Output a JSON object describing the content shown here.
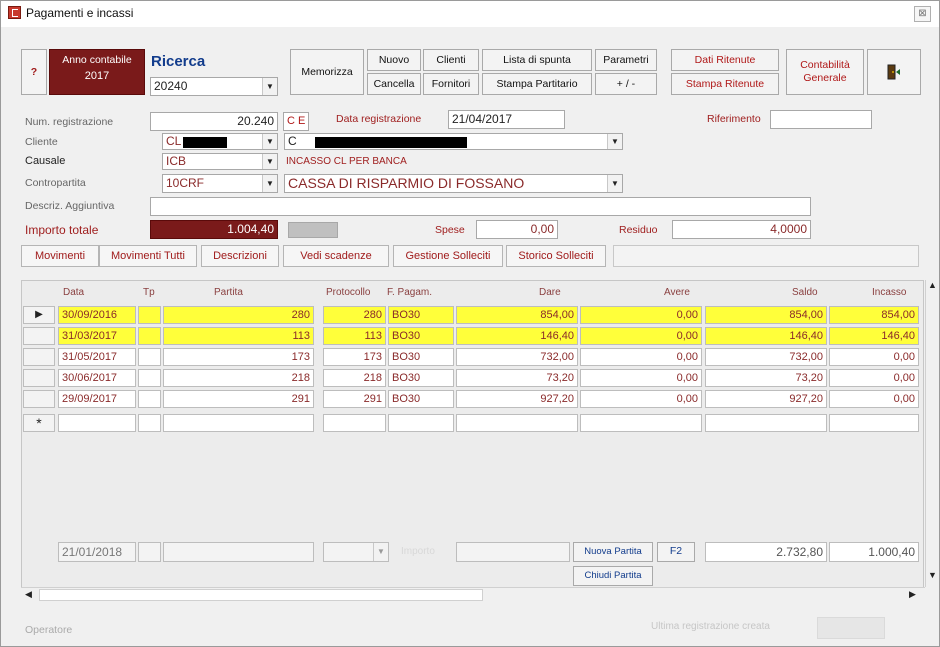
{
  "window": {
    "title": "Pagamenti e incassi",
    "close_label": "⊠"
  },
  "toolbar": {
    "help_label": "?",
    "anno_label": "Anno contabile",
    "anno_value": "2017",
    "ricerca_label": "Ricerca",
    "ricerca_value": "20240",
    "memorizza": "Memorizza",
    "nuovo": "Nuovo",
    "cancella": "Cancella",
    "clienti": "Clienti",
    "fornitori": "Fornitori",
    "lista_spunta": "Lista di spunta",
    "stampa_partitario": "Stampa Partitario",
    "parametri": "Parametri",
    "plus_minus": "+ / -",
    "dati_ritenute": "Dati Ritenute",
    "stampa_ritenute": "Stampa Ritenute",
    "contabilita_generale": "Contabilità Generale"
  },
  "form": {
    "num_reg_label": "Num. registrazione",
    "num_reg_value": "20.240",
    "ce_label": "C E",
    "data_reg_label": "Data registrazione",
    "data_reg_value": "21/04/2017",
    "riferimento_label": "Riferimento",
    "riferimento_value": "",
    "cliente_label": "Cliente",
    "cliente_code": "CL",
    "cliente_name": "C",
    "causale_label": "Causale",
    "causale_code": "ICB",
    "causale_desc": "INCASSO CL PER BANCA",
    "contropartita_label": "Contropartita",
    "contropartita_code": "10CRF",
    "contropartita_desc": "CASSA DI RISPARMIO DI FOSSANO",
    "descr_label": "Descriz. Aggiuntiva",
    "descr_value": "",
    "importo_label": "Importo totale",
    "importo_value": "1.004,40",
    "spese_label": "Spese",
    "spese_value": "0,00",
    "residuo_label": "Residuo",
    "residuo_value": "4,0000"
  },
  "tabs": [
    "Movimenti",
    "Movimenti Tutti",
    "Descrizioni",
    "Vedi scadenze",
    "Gestione Solleciti",
    "Storico Solleciti"
  ],
  "table": {
    "columns": [
      "Data",
      "Tp",
      "Partita",
      "Protocollo",
      "F. Pagam.",
      "Dare",
      "Avere",
      "Saldo",
      "Incasso"
    ],
    "rows": [
      {
        "data": "30/09/2016",
        "tp": "",
        "partita": "280",
        "protocollo": "280",
        "fpag": "BO30",
        "dare": "854,00",
        "avere": "0,00",
        "saldo": "854,00",
        "incasso": "854,00",
        "selected": true
      },
      {
        "data": "31/03/2017",
        "tp": "",
        "partita": "113",
        "protocollo": "113",
        "fpag": "BO30",
        "dare": "146,40",
        "avere": "0,00",
        "saldo": "146,40",
        "incasso": "146,40",
        "selected": true
      },
      {
        "data": "31/05/2017",
        "tp": "",
        "partita": "173",
        "protocollo": "173",
        "fpag": "BO30",
        "dare": "732,00",
        "avere": "0,00",
        "saldo": "732,00",
        "incasso": "0,00",
        "selected": false
      },
      {
        "data": "30/06/2017",
        "tp": "",
        "partita": "218",
        "protocollo": "218",
        "fpag": "BO30",
        "dare": "73,20",
        "avere": "0,00",
        "saldo": "73,20",
        "incasso": "0,00",
        "selected": false
      },
      {
        "data": "29/09/2017",
        "tp": "",
        "partita": "291",
        "protocollo": "291",
        "fpag": "BO30",
        "dare": "927,20",
        "avere": "0,00",
        "saldo": "927,20",
        "incasso": "0,00",
        "selected": false
      }
    ],
    "new_row_marker": "*",
    "current_row_marker": "▶"
  },
  "footer": {
    "date": "21/01/2018",
    "importo_label": "Importo",
    "nuova_partita": "Nuova Partita",
    "f2": "F2",
    "chiudi_partita": "Chiudi Partita",
    "total_saldo": "2.732,80",
    "total_incasso": "1.000,40"
  },
  "status": {
    "operatore_label": "Operatore",
    "ultima_label": "Ultima registrazione creata"
  },
  "colors": {
    "accent_dark_red": "#7a1a1a",
    "selection_yellow": "#ffff3a"
  }
}
